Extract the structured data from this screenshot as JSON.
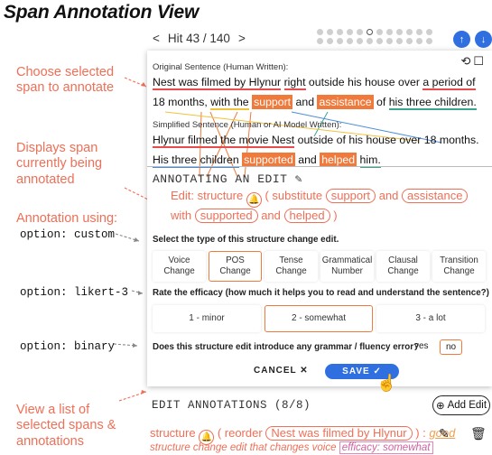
{
  "title": "Span Annotation View",
  "nav": {
    "prev": "<",
    "hit_label": "Hit 43 / 140",
    "next": ">",
    "up": "↑",
    "down": "↓"
  },
  "annotations": {
    "choose": "Choose selected span to annotate",
    "displays": "Displays span currently being annotated",
    "using": "Annotation using:",
    "opt_custom": "option: custom",
    "opt_likert": "option: likert-3",
    "opt_binary": "option: binary",
    "view_list": "View a list of selected spans & annotations"
  },
  "original": {
    "label": "Original Sentence (Human Written):",
    "p1": "Nest was filmed by Hlynur",
    "p2": "right",
    "p3": "outside his house over",
    "p4": "a period of",
    "p5": "18 months,",
    "p6": "with the",
    "p7": "support",
    "p8": "and",
    "p9": "assistance",
    "p10": "of",
    "p11": "his three children."
  },
  "simplified": {
    "label": "Simplified Sentence (Human or AI Model Written):",
    "p1": "Hlynur filmed the movie Nest",
    "p2": "outside of his house over 18 months.",
    "p3": "His three children",
    "p4": "supported",
    "p5": "and",
    "p6": "helped",
    "p7": "him."
  },
  "editor": {
    "title": "ANNOTATING AN EDIT",
    "edit_prefix": "Edit:",
    "edit_type": "structure",
    "substitute": "( substitute",
    "src1": "support",
    "and1": "and",
    "src2": "assistance",
    "with": "with",
    "tgt1": "supported",
    "and2": "and",
    "tgt2": "helped",
    "close": ")"
  },
  "q1": {
    "label": "Select the type of this structure change edit.",
    "options": [
      "Voice Change",
      "POS Change",
      "Tense Change",
      "Grammatical Number",
      "Clausal Change",
      "Transition Change"
    ]
  },
  "q2": {
    "label": "Rate the efficacy (how much it helps you to read and understand the sentence?)",
    "options": [
      "1 - minor",
      "2 - somewhat",
      "3 - a lot"
    ]
  },
  "q3": {
    "label": "Does this structure edit introduce any grammar / fluency error?",
    "yes": "yes",
    "no": "no"
  },
  "actions": {
    "cancel": "CANCEL ✕",
    "save": "SAVE ✓"
  },
  "edit_list": {
    "title": "EDIT ANNOTATIONS (8/8)",
    "add": "Add Edit",
    "item_type": "structure",
    "reorder": "( reorder",
    "reorder_span": "Nest was filmed by Hlynur",
    "close": ") :",
    "good": "good",
    "desc": "structure change edit that changes voice",
    "efficacy": "efficacy: somewhat"
  },
  "colors": {
    "accent": "#ef6f57",
    "highlight": "#ef7a3c",
    "primary": "#2f6fe0"
  }
}
